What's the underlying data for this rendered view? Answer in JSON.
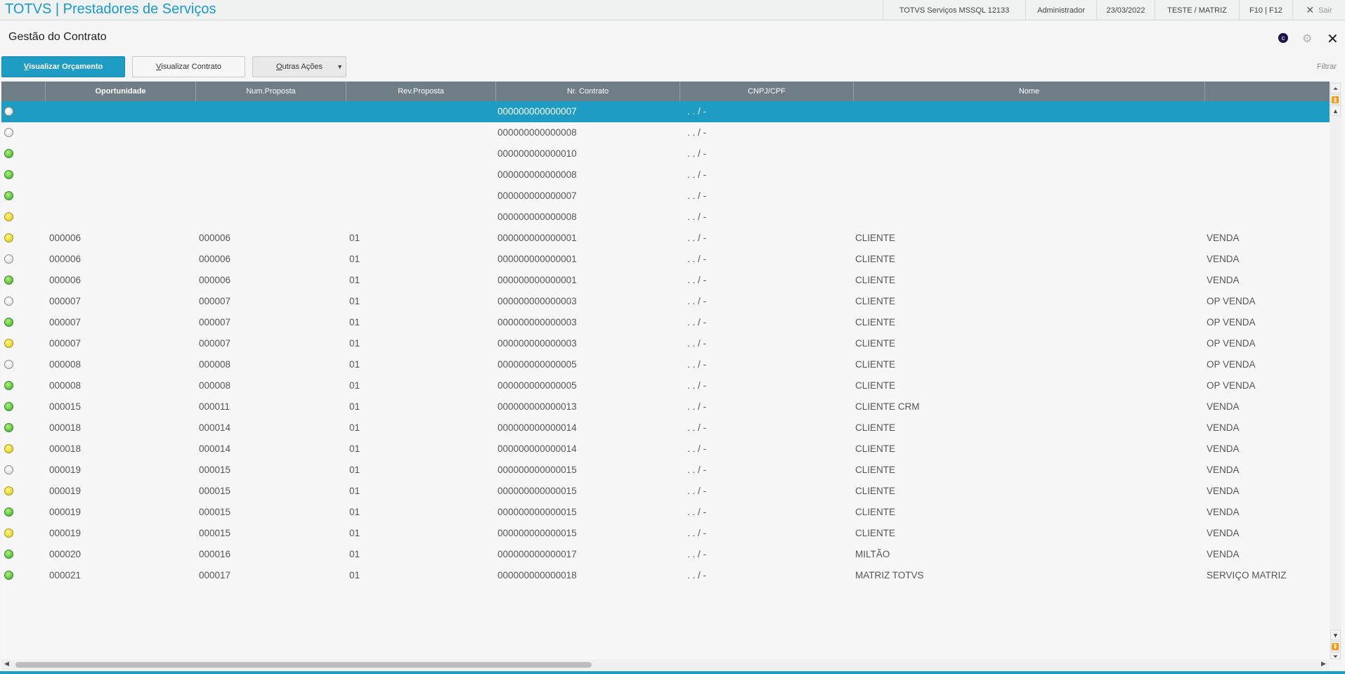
{
  "topbar": {
    "app_title": "TOTVS | Prestadores de Serviços",
    "environment": "TOTVS Serviços MSSQL 12133",
    "user": "Administrador",
    "date": "23/03/2022",
    "company": "TESTE / MATRIZ",
    "shortcuts": "F10 | F12",
    "exit_label": "Sair"
  },
  "header": {
    "title": "Gestão do Contrato",
    "circle_icon_letter": "c"
  },
  "toolbar": {
    "btn_orcamento_first": "V",
    "btn_orcamento_rest": "isualizar Orçamento",
    "btn_contrato_first": "V",
    "btn_contrato_rest": "isualizar Contrato",
    "btn_acoes_first": "O",
    "btn_acoes_rest": "utras Ações",
    "filter_label": "Filtrar"
  },
  "grid": {
    "columns": [
      "Oportunidade",
      "Num.Proposta",
      "Rev.Proposta",
      "Nr. Contrato",
      "CNPJ/CPF",
      "Nome"
    ],
    "rows": [
      {
        "status": "white",
        "oportunidade": "",
        "proposta": "",
        "revisao": "",
        "contrato": "000000000000007",
        "cnpj": ". .  /    -",
        "nome": "",
        "extra": "",
        "selected": true
      },
      {
        "status": "white",
        "oportunidade": "",
        "proposta": "",
        "revisao": "",
        "contrato": "000000000000008",
        "cnpj": ". .  /    -",
        "nome": "",
        "extra": ""
      },
      {
        "status": "green",
        "oportunidade": "",
        "proposta": "",
        "revisao": "",
        "contrato": "000000000000010",
        "cnpj": ". .  /    -",
        "nome": "",
        "extra": ""
      },
      {
        "status": "green",
        "oportunidade": "",
        "proposta": "",
        "revisao": "",
        "contrato": "000000000000008",
        "cnpj": ". .  /    -",
        "nome": "",
        "extra": ""
      },
      {
        "status": "green",
        "oportunidade": "",
        "proposta": "",
        "revisao": "",
        "contrato": "000000000000007",
        "cnpj": ". .  /    -",
        "nome": "",
        "extra": ""
      },
      {
        "status": "yellow",
        "oportunidade": "",
        "proposta": "",
        "revisao": "",
        "contrato": "000000000000008",
        "cnpj": ". .  /    -",
        "nome": "",
        "extra": ""
      },
      {
        "status": "yellow",
        "oportunidade": "000006",
        "proposta": "000006",
        "revisao": "01",
        "contrato": "000000000000001",
        "cnpj": ". .  /    -",
        "nome": "CLIENTE",
        "extra": "VENDA"
      },
      {
        "status": "white",
        "oportunidade": "000006",
        "proposta": "000006",
        "revisao": "01",
        "contrato": "000000000000001",
        "cnpj": ". .  /    -",
        "nome": "CLIENTE",
        "extra": "VENDA"
      },
      {
        "status": "green",
        "oportunidade": "000006",
        "proposta": "000006",
        "revisao": "01",
        "contrato": "000000000000001",
        "cnpj": ". .  /    -",
        "nome": "CLIENTE",
        "extra": "VENDA"
      },
      {
        "status": "white",
        "oportunidade": "000007",
        "proposta": "000007",
        "revisao": "01",
        "contrato": "000000000000003",
        "cnpj": ". .  /    -",
        "nome": "CLIENTE",
        "extra": "OP VENDA"
      },
      {
        "status": "green",
        "oportunidade": "000007",
        "proposta": "000007",
        "revisao": "01",
        "contrato": "000000000000003",
        "cnpj": ". .  /    -",
        "nome": "CLIENTE",
        "extra": "OP VENDA"
      },
      {
        "status": "yellow",
        "oportunidade": "000007",
        "proposta": "000007",
        "revisao": "01",
        "contrato": "000000000000003",
        "cnpj": ". .  /    -",
        "nome": "CLIENTE",
        "extra": "OP VENDA"
      },
      {
        "status": "white",
        "oportunidade": "000008",
        "proposta": "000008",
        "revisao": "01",
        "contrato": "000000000000005",
        "cnpj": ". .  /    -",
        "nome": "CLIENTE",
        "extra": "OP VENDA"
      },
      {
        "status": "green",
        "oportunidade": "000008",
        "proposta": "000008",
        "revisao": "01",
        "contrato": "000000000000005",
        "cnpj": ". .  /    -",
        "nome": "CLIENTE",
        "extra": "OP VENDA"
      },
      {
        "status": "green",
        "oportunidade": "000015",
        "proposta": "000011",
        "revisao": "01",
        "contrato": "000000000000013",
        "cnpj": ". .  /    -",
        "nome": "CLIENTE CRM",
        "extra": "VENDA"
      },
      {
        "status": "green",
        "oportunidade": "000018",
        "proposta": "000014",
        "revisao": "01",
        "contrato": "000000000000014",
        "cnpj": ". .  /    -",
        "nome": "CLIENTE",
        "extra": "VENDA"
      },
      {
        "status": "yellow",
        "oportunidade": "000018",
        "proposta": "000014",
        "revisao": "01",
        "contrato": "000000000000014",
        "cnpj": ". .  /    -",
        "nome": "CLIENTE",
        "extra": "VENDA"
      },
      {
        "status": "white",
        "oportunidade": "000019",
        "proposta": "000015",
        "revisao": "01",
        "contrato": "000000000000015",
        "cnpj": ". .  /    -",
        "nome": "CLIENTE",
        "extra": "VENDA"
      },
      {
        "status": "yellow",
        "oportunidade": "000019",
        "proposta": "000015",
        "revisao": "01",
        "contrato": "000000000000015",
        "cnpj": ". .  /    -",
        "nome": "CLIENTE",
        "extra": "VENDA"
      },
      {
        "status": "green",
        "oportunidade": "000019",
        "proposta": "000015",
        "revisao": "01",
        "contrato": "000000000000015",
        "cnpj": ". .  /    -",
        "nome": "CLIENTE",
        "extra": "VENDA"
      },
      {
        "status": "yellow",
        "oportunidade": "000019",
        "proposta": "000015",
        "revisao": "01",
        "contrato": "000000000000015",
        "cnpj": ". .  /    -",
        "nome": "CLIENTE",
        "extra": "VENDA"
      },
      {
        "status": "green",
        "oportunidade": "000020",
        "proposta": "000016",
        "revisao": "01",
        "contrato": "000000000000017",
        "cnpj": ". .  /    -",
        "nome": "MILTÃO",
        "extra": "VENDA"
      },
      {
        "status": "green",
        "oportunidade": "000021",
        "proposta": "000017",
        "revisao": "01",
        "contrato": "000000000000018",
        "cnpj": ". .  /    -",
        "nome": "MATRIZ TOTVS",
        "extra": "SERVIÇO MATRIZ"
      }
    ]
  },
  "colors": {
    "accent": "#1e9cc4",
    "header_bg": "#6f7d86",
    "status_green": "#3aa52b",
    "status_yellow": "#d8c515",
    "status_white": "#e0e0e0"
  }
}
